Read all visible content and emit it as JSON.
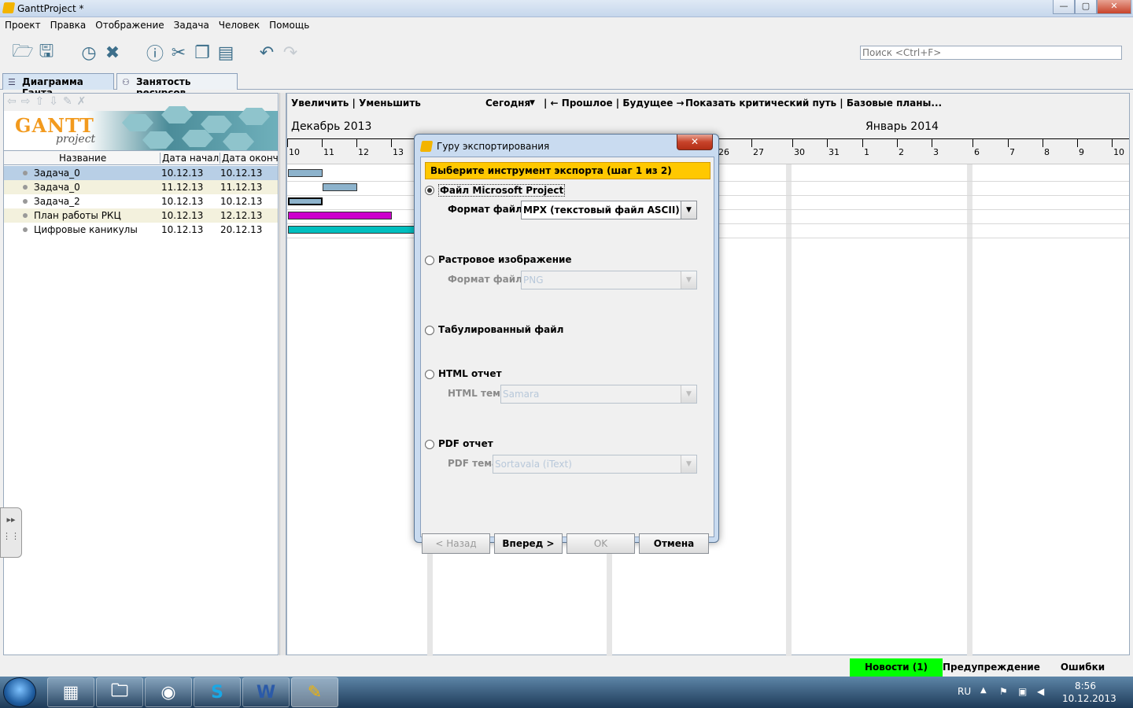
{
  "window": {
    "title": "GanttProject *",
    "min": "—",
    "max": "▢",
    "close": "✕"
  },
  "menu": [
    "Проект",
    "Правка",
    "Отображение",
    "Задача",
    "Человек",
    "Помощь"
  ],
  "search": {
    "placeholder": "Поиск <Ctrl+F>"
  },
  "tabs": [
    {
      "label": "Диаграмма Ганта",
      "active": true
    },
    {
      "label": "Занятость ресурсов",
      "active": false
    }
  ],
  "logo": {
    "main": "GANTT",
    "sub": "project"
  },
  "table": {
    "headers": [
      "Название",
      "Дата начала",
      "Дата оконч..."
    ],
    "rows": [
      {
        "name": "Задача_0",
        "start": "10.12.13",
        "end": "10.12.13"
      },
      {
        "name": "Задача_0",
        "start": "11.12.13",
        "end": "11.12.13"
      },
      {
        "name": "Задача_2",
        "start": "10.12.13",
        "end": "10.12.13"
      },
      {
        "name": "План работы РКЦ",
        "start": "10.12.13",
        "end": "12.12.13"
      },
      {
        "name": "Цифровые каникулы",
        "start": "10.12.13",
        "end": "20.12.13"
      }
    ]
  },
  "gantt": {
    "toolbar": {
      "zoom": "Увеличить  |  Уменьшить",
      "today": "Сегодня",
      "nav": "|  ← Прошлое  |  Будущее →",
      "critical": "Показать критический путь  |  Базовые планы..."
    },
    "months": [
      "Декабрь 2013",
      "Январь 2014"
    ],
    "days": [
      "10",
      "11",
      "12",
      "13",
      "26",
      "27",
      "30",
      "31",
      "1",
      "2",
      "3",
      "6",
      "7",
      "8",
      "9",
      "10"
    ],
    "colors": {
      "task": "#8db3cc",
      "plan": "#cc00cc",
      "holiday": "#00bfbf"
    }
  },
  "dialog": {
    "title": "Гуру экспортирования",
    "close": "✕",
    "banner": "Выберите инструмент экспорта (шаг 1 из 2)",
    "options": {
      "msproject": {
        "label": "Файл Microsoft Project",
        "field_label": "Формат файла",
        "value": "MPX (текстовый файл ASCII)"
      },
      "raster": {
        "label": "Растровое изображение",
        "field_label": "Формат файла",
        "value": "PNG"
      },
      "tabular": {
        "label": "Табулированный файл"
      },
      "html": {
        "label": "HTML отчет",
        "field_label": "HTML тема",
        "value": "Samara"
      },
      "pdf": {
        "label": "PDF отчет",
        "field_label": "PDF тема",
        "value": "Sortavala (iText)"
      }
    },
    "buttons": {
      "back": "< Назад",
      "next": "Вперед >",
      "ok": "OK",
      "cancel": "Отмена"
    }
  },
  "status": {
    "news": "Новости (1)",
    "warning": "Предупреждение",
    "errors": "Ошибки",
    "news_color": "#00ff00"
  },
  "taskbar": {
    "lang": "RU",
    "time": "8:56",
    "date": "10.12.2013"
  }
}
